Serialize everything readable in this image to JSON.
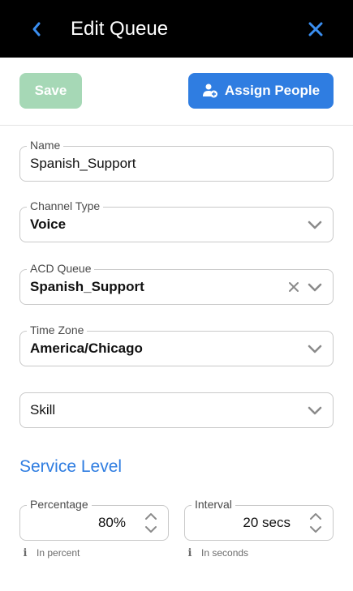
{
  "header": {
    "title": "Edit Queue",
    "back_icon": "chevron-left-icon",
    "close_icon": "close-icon",
    "icon_color": "#3a8ef0"
  },
  "toolbar": {
    "save_label": "Save",
    "assign_label": "Assign People",
    "assign_icon": "person-add-icon"
  },
  "form": {
    "name": {
      "label": "Name",
      "value": "Spanish_Support"
    },
    "channel_type": {
      "label": "Channel Type",
      "value": "Voice"
    },
    "acd_queue": {
      "label": "ACD Queue",
      "value": "Spanish_Support"
    },
    "time_zone": {
      "label": "Time Zone",
      "value": "America/Chicago"
    },
    "skill": {
      "placeholder": "Skill"
    }
  },
  "service_level": {
    "title": "Service Level",
    "percentage": {
      "label": "Percentage",
      "value": "80%",
      "hint": "In percent"
    },
    "interval": {
      "label": "Interval",
      "value": "20 secs",
      "hint": "In seconds"
    }
  },
  "colors": {
    "accent": "#2f7de1",
    "save_disabled": "#a6d8b6",
    "header_bg": "#000000"
  }
}
